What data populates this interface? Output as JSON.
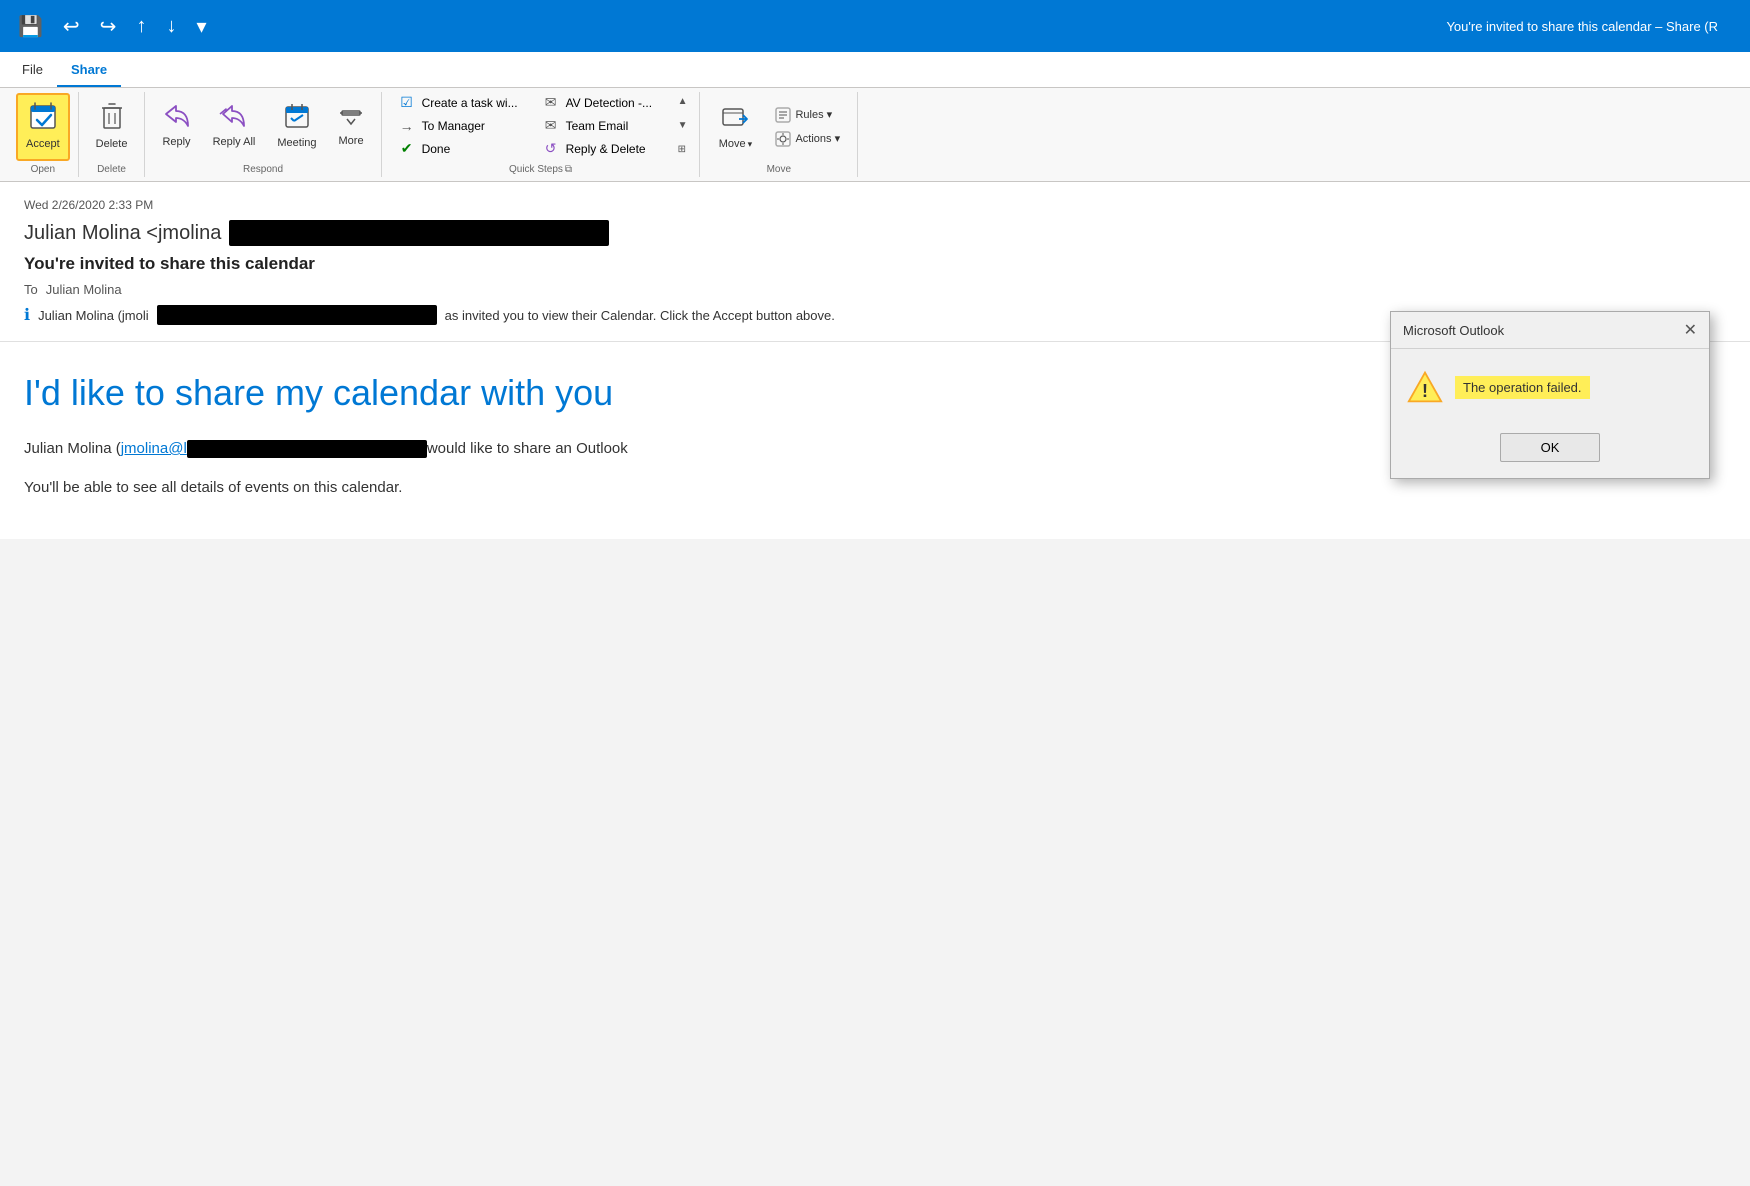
{
  "titlebar": {
    "title": "You're invited to share this calendar  –  Share (R",
    "save_icon": "💾",
    "undo_icon": "↩",
    "redo_icon": "↪",
    "up_icon": "↑",
    "down_icon": "↓",
    "customize_icon": "▾"
  },
  "tabs": [
    {
      "id": "file",
      "label": "File"
    },
    {
      "id": "share",
      "label": "Share"
    }
  ],
  "ribbon": {
    "groups": {
      "open": {
        "label": "Open",
        "buttons": [
          {
            "id": "accept",
            "icon": "📅",
            "label": "Accept",
            "highlighted": true
          }
        ]
      },
      "delete": {
        "label": "Delete",
        "buttons": [
          {
            "id": "delete",
            "icon": "🗑️",
            "label": "Delete"
          }
        ]
      },
      "respond": {
        "label": "Respond",
        "buttons": [
          {
            "id": "reply",
            "icon": "✉",
            "label": "Reply"
          },
          {
            "id": "reply-all",
            "icon": "✉✉",
            "label": "Reply All"
          },
          {
            "id": "meeting",
            "icon": "📅",
            "label": "Meeting"
          },
          {
            "id": "more",
            "icon": "⋯",
            "label": "More"
          }
        ]
      },
      "quick-steps": {
        "label": "Quick Steps",
        "items": [
          {
            "id": "create-task",
            "icon": "☑",
            "label": "Create a task wi..."
          },
          {
            "id": "to-manager",
            "icon": "→",
            "label": "To Manager"
          },
          {
            "id": "done",
            "icon": "✔",
            "label": "Done"
          },
          {
            "id": "av-detection",
            "icon": "✉",
            "label": "AV Detection -..."
          },
          {
            "id": "team-email",
            "icon": "✉",
            "label": "Team Email"
          },
          {
            "id": "reply-delete",
            "icon": "↺",
            "label": "Reply & Delete"
          }
        ]
      },
      "move": {
        "label": "Move",
        "buttons": [
          {
            "id": "move",
            "icon": "📁",
            "label": "Move"
          }
        ],
        "stack_buttons": [
          {
            "id": "rules",
            "icon": "🔲",
            "label": "Rules ▾"
          },
          {
            "id": "actions",
            "icon": "🔲",
            "label": "Actions ▾"
          }
        ]
      }
    }
  },
  "email": {
    "date": "Wed 2/26/2020 2:33 PM",
    "from_name": "Julian Molina <jmolina",
    "subject": "You're invited to share this calendar",
    "to_label": "To",
    "to_name": "Julian Molina",
    "info_text_prefix": "Julian Molina (jmoli",
    "info_text_suffix": "as invited you to view their Calendar.  Click the Accept button above."
  },
  "email_body": {
    "heading": "I'd like to share my calendar with you",
    "para1_prefix": "Julian Molina (",
    "para1_link": "jmolina@l",
    "para1_suffix": "would like to share an Outlook",
    "para2": "You'll be able to see all details of events on this calendar."
  },
  "dialog": {
    "title": "Microsoft Outlook",
    "message": "The operation failed.",
    "ok_label": "OK"
  }
}
